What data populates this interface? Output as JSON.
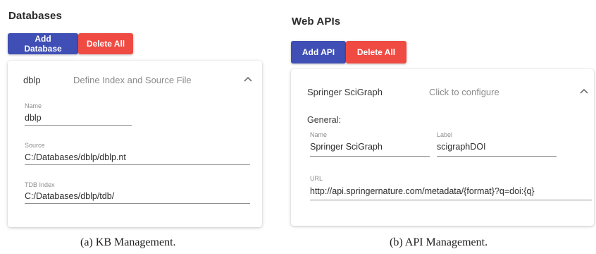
{
  "left_panel": {
    "title": "Databases",
    "add_button": "Add Database",
    "delete_button": "Delete All",
    "card": {
      "name": "dblp",
      "description": "Define Index and Source File",
      "fields": [
        {
          "label": "Name",
          "value": "dblp"
        },
        {
          "label": "Source",
          "value": "C:/Databases/dblp/dblp.nt"
        },
        {
          "label": "TDB Index",
          "value": "C:/Databases/dblp/tdb/"
        }
      ]
    },
    "caption": "(a) KB Management."
  },
  "right_panel": {
    "title": "Web APIs",
    "add_button": "Add API",
    "delete_button": "Delete All",
    "card": {
      "name": "Springer SciGraph",
      "description": "Click to configure",
      "section": "General:",
      "fields": [
        {
          "label": "Name",
          "value": "Springer SciGraph"
        },
        {
          "label": "Label",
          "value": "scigraphDOI"
        },
        {
          "label": "URL",
          "value": "http://api.springernature.com/metadata/{format}?q=doi:{q}"
        }
      ]
    },
    "caption": "(b) API Management."
  },
  "colors": {
    "primary": "#3f4fb5",
    "danger": "#ef4b43"
  },
  "icons": {
    "expand": "chevron-up-icon"
  }
}
